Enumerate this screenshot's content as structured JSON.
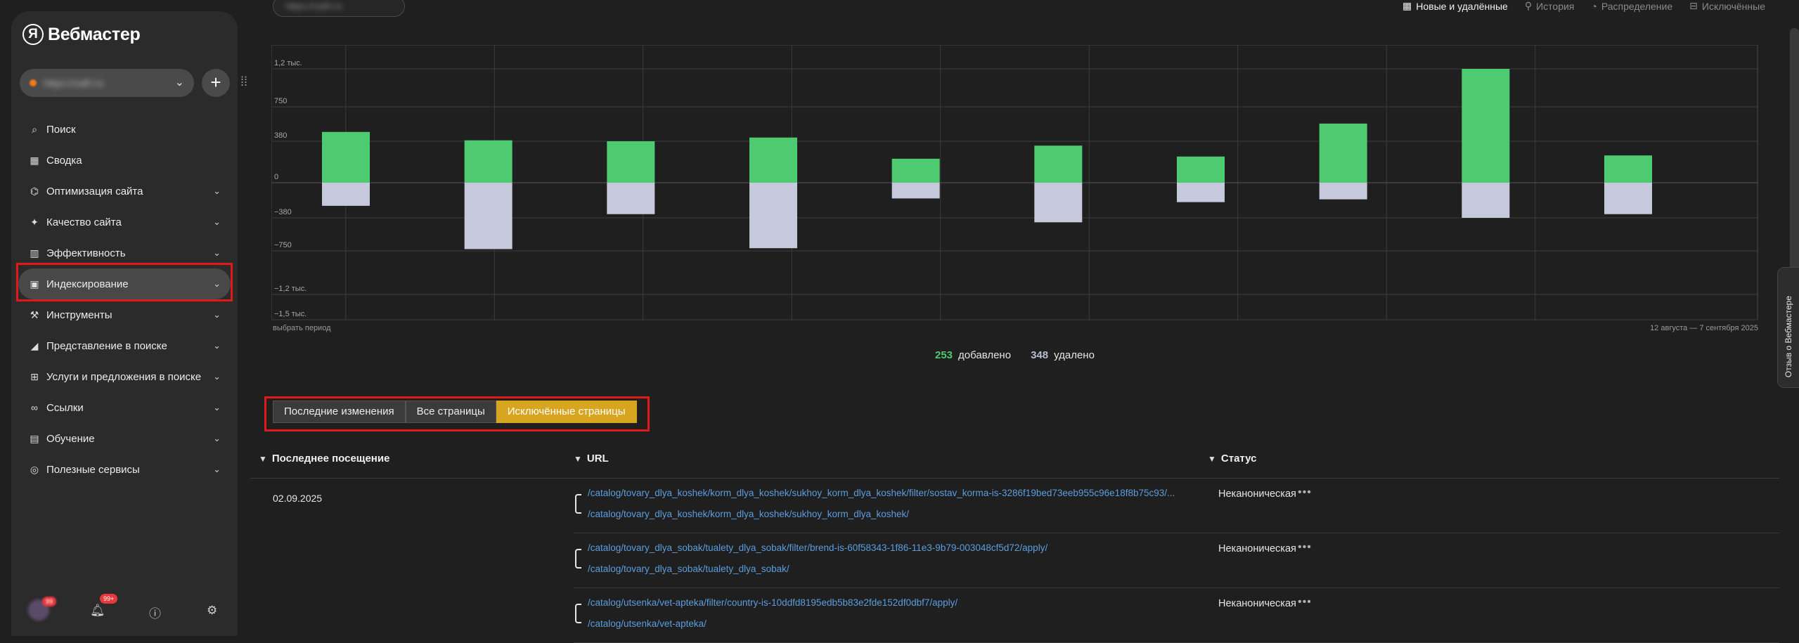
{
  "brand": {
    "logo_letter": "Я",
    "name": "Вебмастер"
  },
  "site_selector": {
    "value": "https://сайт.ru",
    "chevron": "chevron-down-icon"
  },
  "nav": [
    {
      "label": "Поиск",
      "icon": "search-icon",
      "expandable": false
    },
    {
      "label": "Сводка",
      "icon": "grid-icon",
      "expandable": false
    },
    {
      "label": "Оптимизация сайта",
      "icon": "sitemap-icon",
      "expandable": true
    },
    {
      "label": "Качество сайта",
      "icon": "sparkle-icon",
      "expandable": true
    },
    {
      "label": "Эффективность",
      "icon": "bar-chart-icon",
      "expandable": true
    },
    {
      "label": "Индексирование",
      "icon": "index-icon",
      "expandable": true,
      "active": true
    },
    {
      "label": "Инструменты",
      "icon": "wrench-icon",
      "expandable": true
    },
    {
      "label": "Представление в поиске",
      "icon": "megaphone-icon",
      "expandable": true
    },
    {
      "label": "Услуги и предложения в поиске",
      "icon": "cart-icon",
      "expandable": true
    },
    {
      "label": "Ссылки",
      "icon": "link-icon",
      "expandable": true
    },
    {
      "label": "Обучение",
      "icon": "book-icon",
      "expandable": true
    },
    {
      "label": "Полезные сервисы",
      "icon": "apps-icon",
      "expandable": true
    }
  ],
  "bottom_bar": {
    "avatar_badge": "99",
    "notif_badge": "99+"
  },
  "top_pill": "https://сайт.ru",
  "view_tabs": [
    {
      "label": "Новые и удалённые",
      "icon": "table-icon",
      "selected": true
    },
    {
      "label": "История",
      "icon": "history-icon",
      "selected": false
    },
    {
      "label": "Распределение",
      "icon": "pie-icon",
      "selected": false
    },
    {
      "label": "Исключённые",
      "icon": "exclude-icon",
      "selected": false
    }
  ],
  "chart_data": {
    "type": "bar",
    "stacked": true,
    "ytick_labels": [
      "1,2 тыс.",
      "750",
      "380",
      "0",
      "−380",
      "−750",
      "−1,2 тыс.",
      "−1,5 тыс."
    ],
    "ytick_values": [
      1200,
      750,
      380,
      0,
      -380,
      -750,
      -1200,
      -1500
    ],
    "ylim": [
      -1500,
      1500
    ],
    "grid": true,
    "series": [
      {
        "name": "добавлено",
        "color": "#4ecb71",
        "values": [
          480,
          390,
          380,
          420,
          220,
          340,
          240,
          570,
          1350,
          250
        ]
      },
      {
        "name": "удалено",
        "color": "#c6c8dc",
        "values": [
          -250,
          -730,
          -340,
          -720,
          -170,
          -430,
          -210,
          -180,
          -380,
          -340
        ]
      }
    ],
    "period_label": "выбрать период",
    "date_range": "12 августа — 7 сентября 2025"
  },
  "summary": {
    "added_count": "253",
    "added_label": "добавлено",
    "deleted_count": "348",
    "deleted_label": "удалено"
  },
  "segments": [
    {
      "label": "Последние изменения",
      "selected": false
    },
    {
      "label": "Все страницы",
      "selected": false
    },
    {
      "label": "Исключённые страницы",
      "selected": true
    }
  ],
  "table": {
    "headers": {
      "last_visit": "Последнее посещение",
      "url": "URL",
      "status": "Статус"
    },
    "date": "02.09.2025",
    "rows": [
      {
        "url": "/catalog/tovary_dlya_koshek/korm_dlya_koshek/sukhoy_korm_dlya_koshek/filter/sostav_korma-is-3286f19bed73eeb955c96e18f8b75c93/...",
        "canonical": "/catalog/tovary_dlya_koshek/korm_dlya_koshek/sukhoy_korm_dlya_koshek/",
        "status": "Неканоническая"
      },
      {
        "url": "/catalog/tovary_dlya_sobak/tualety_dlya_sobak/filter/brend-is-60f58343-1f86-11e3-9b79-003048cf5d72/apply/",
        "canonical": "/catalog/tovary_dlya_sobak/tualety_dlya_sobak/",
        "status": "Неканоническая"
      },
      {
        "url": "/catalog/utsenka/vet-apteka/filter/country-is-10ddfd8195edb5b83e2fde152df0dbf7/apply/",
        "canonical": "/catalog/utsenka/vet-apteka/",
        "status": "Неканоническая"
      }
    ]
  },
  "feedback_tab": "Отзыв о Вебмастере"
}
